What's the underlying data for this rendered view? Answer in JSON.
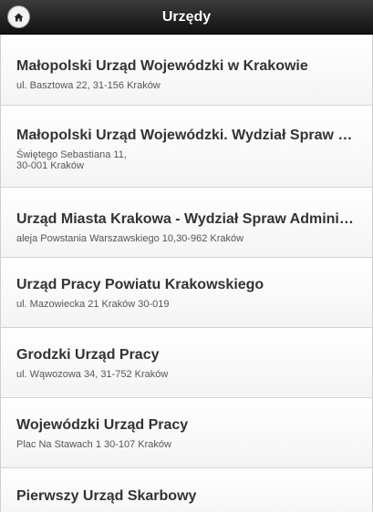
{
  "header": {
    "title": "Urzędy",
    "home_icon": "home-icon"
  },
  "items": [
    {
      "name": "Małopolski Urząd Wojewódzki w Krakowie",
      "address": "ul. Basztowa 22, 31-156 Kraków"
    },
    {
      "name": "Małopolski Urząd Wojewódzki. Wydział Spraw Obywatelskich",
      "address": "Świętego Sebastiana 11,\n30-001 Kraków"
    },
    {
      "name": "Urząd Miasta Krakowa - Wydział Spraw Administracyjnych",
      "address": "aleja Powstania Warszawskiego 10,30-962 Kraków"
    },
    {
      "name": "Urząd Pracy Powiatu Krakowskiego",
      "address": "ul. Mazowiecka 21 Kraków 30-019"
    },
    {
      "name": "Grodzki Urząd Pracy",
      "address": "ul. Wąwozowa 34, 31-752 Kraków"
    },
    {
      "name": "Wojewódzki Urząd Pracy",
      "address": "Plac Na Stawach 1 30-107 Kraków"
    },
    {
      "name": "Pierwszy Urząd Skarbowy",
      "address": ""
    }
  ]
}
